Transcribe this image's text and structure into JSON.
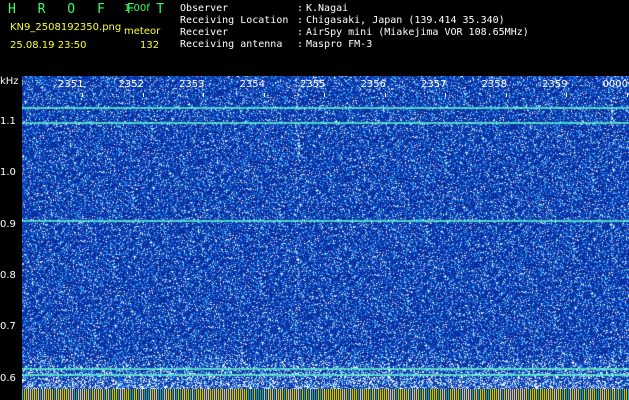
{
  "header": {
    "brand": "H R O F F T",
    "version": "1.00f",
    "filename": "KN9_2508192350.png",
    "meteor_label": "meteor",
    "datetime": "25.08.19 23:50",
    "count": "132",
    "fields": [
      {
        "label": "Observer",
        "value": "K.Nagai"
      },
      {
        "label": "Receiving Location",
        "value": "Chigasaki, Japan (139.414 35.340)"
      },
      {
        "label": "Receiver",
        "value": "AirSpy mini (Miakejima VOR 108.65MHz)"
      },
      {
        "label": "Receiving antenna",
        "value": "Maspro FM-3"
      }
    ],
    "colon": ":"
  },
  "colors": {
    "background": "#0a2a9a",
    "noise_hot": "#ffffff",
    "noise_warm": "#33ccff",
    "band": "#66ffcc",
    "header_green": "#33ff66",
    "header_yellow": "#ffff33"
  },
  "chart_data": {
    "type": "heatmap",
    "ylabel": "kHz",
    "y_ticks": [
      "1.1",
      "1.0",
      "0.9",
      "0.8",
      "0.7",
      "0.6"
    ],
    "x_ticks": [
      "2351",
      "2352",
      "2353",
      "2354",
      "2355",
      "2356",
      "2357",
      "2358",
      "2359",
      "0000"
    ],
    "ylim": [
      0.58,
      1.19
    ],
    "carriers_khz": [
      1.13,
      1.1,
      0.91,
      0.62,
      0.61
    ]
  }
}
